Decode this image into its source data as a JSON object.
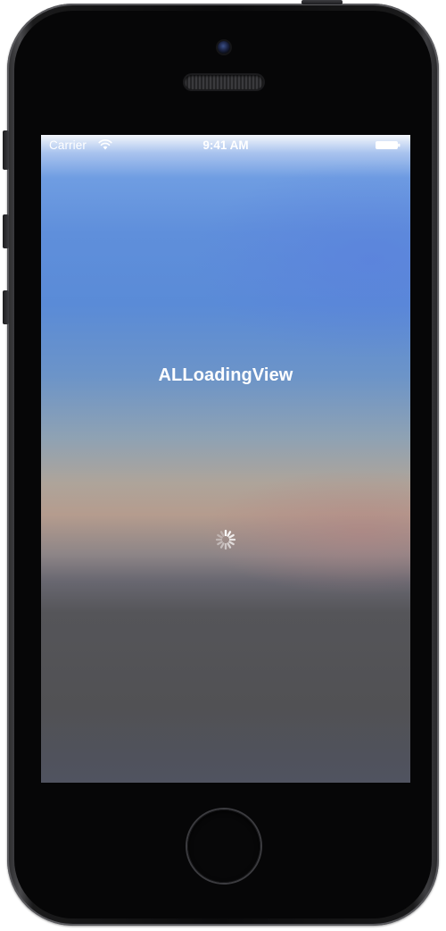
{
  "status_bar": {
    "carrier": "Carrier",
    "time": "9:41 AM",
    "wifi_icon": "wifi-icon",
    "battery_icon": "battery-full-icon"
  },
  "screen": {
    "title": "ALLoadingView",
    "spinner_icon": "activity-indicator-icon"
  },
  "colors": {
    "status_text": "#ffffff",
    "title_text": "#ffffff",
    "sky_blue": "#5a8bd7",
    "horizon_peach": "#b59c8e",
    "ground_gray": "#515154",
    "device_body": "#0b0b0c"
  }
}
